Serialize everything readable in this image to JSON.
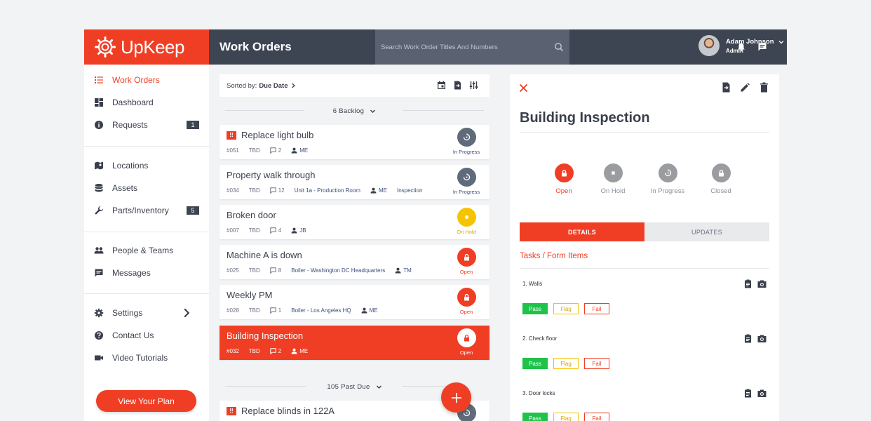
{
  "brand": {
    "name": "UpKeep"
  },
  "header": {
    "title": "Work Orders",
    "search_placeholder": "Search Work Order Titles And Numbers",
    "user": {
      "name": "Adam Johnson",
      "role": "Admin"
    }
  },
  "sidebar": {
    "items": [
      {
        "label": "Work Orders",
        "icon": "list-icon",
        "active": true
      },
      {
        "label": "Dashboard",
        "icon": "dashboard-icon"
      },
      {
        "label": "Requests",
        "icon": "info-icon",
        "badge": "1"
      },
      {
        "label": "Locations",
        "icon": "map-icon"
      },
      {
        "label": "Assets",
        "icon": "database-icon"
      },
      {
        "label": "Parts/Inventory",
        "icon": "wrench-icon",
        "badge": "5"
      },
      {
        "label": "People & Teams",
        "icon": "people-icon"
      },
      {
        "label": "Messages",
        "icon": "message-icon"
      },
      {
        "label": "Settings",
        "icon": "gear-icon"
      },
      {
        "label": "Contact Us",
        "icon": "help-icon"
      },
      {
        "label": "Video Tutorials",
        "icon": "video-icon"
      }
    ],
    "plan_button": "View Your Plan"
  },
  "list": {
    "sort_label": "Sorted by:",
    "sort_value": "Due Date",
    "groups": [
      {
        "label": "6 Backlog"
      },
      {
        "label": "105 Past Due"
      }
    ],
    "cards": [
      {
        "title": "Replace light bulb",
        "priority": "!!",
        "number": "#051",
        "due": "TBD",
        "comments": "2",
        "location": "",
        "assignee": "ME",
        "category": "",
        "status": "In Progress"
      },
      {
        "title": "Property walk through",
        "number": "#034",
        "due": "TBD",
        "comments": "12",
        "location": "Unit 1a - Production Room",
        "assignee": "ME",
        "category": "Inspection",
        "status": "In Progress"
      },
      {
        "title": "Broken door",
        "number": "#007",
        "due": "TBD",
        "comments": "4",
        "location": "",
        "assignee": "JB",
        "category": "",
        "status": "On Hold"
      },
      {
        "title": "Machine A is down",
        "number": "#025",
        "due": "TBD",
        "comments": "8",
        "location": "Boiler - Washington DC Headquarters",
        "assignee": "TM",
        "category": "",
        "status": "Open"
      },
      {
        "title": "Weekly PM",
        "number": "#028",
        "due": "TBD",
        "comments": "1",
        "location": "Boiler - Los Angeles HQ",
        "assignee": "ME",
        "category": "",
        "status": "Open"
      },
      {
        "title": "Building Inspection",
        "number": "#032",
        "due": "TBD",
        "comments": "2",
        "location": "",
        "assignee": "ME",
        "category": "",
        "status": "Open",
        "selected": true
      },
      {
        "title": "Replace blinds in 122A",
        "priority": "!!",
        "number": "",
        "due": "",
        "comments": "",
        "location": "",
        "assignee": "",
        "category": "",
        "status": "In Progress"
      }
    ]
  },
  "detail": {
    "title": "Building Inspection",
    "states": [
      "Open",
      "On Hold",
      "In Progress",
      "Closed"
    ],
    "active_state": "Open",
    "tabs": [
      "DETAILS",
      "UPDATES"
    ],
    "section_title": "Tasks / Form Items",
    "tasks": [
      {
        "name": "1. Walls"
      },
      {
        "name": "2. Check floor"
      },
      {
        "name": "3. Door locks"
      }
    ],
    "options": [
      "Pass",
      "Flag",
      "Fail"
    ]
  },
  "colors": {
    "brand_red": "#f03e25",
    "topbar": "#3d4452",
    "in_progress": "#5f6b7a",
    "on_hold": "#f5c400",
    "pass_green": "#1fc34a"
  }
}
